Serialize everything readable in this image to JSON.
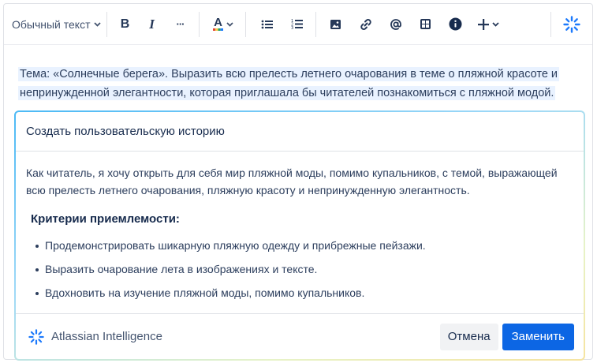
{
  "toolbar": {
    "text_style": "Обычный текст",
    "bold_label": "B",
    "italic_label": "I",
    "more_label": "···",
    "color_label": "A",
    "icons": [
      "chevron-down-icon",
      "bullet-list-icon",
      "numbered-list-icon",
      "image-icon",
      "link-icon",
      "mention-icon",
      "table-icon",
      "info-icon",
      "plus-icon",
      "atlassian-intelligence-icon"
    ]
  },
  "editor": {
    "selected_text": "Тема: «Солнечные берега». Выразить всю прелесть летнего очарования в теме о пляжной красоте и непринужденной элегантности, которая приглашала бы читателей познакомиться с пляжной модой."
  },
  "ai_panel": {
    "title": "Создать пользовательскую историю",
    "description": "Как читатель, я хочу открыть для себя мир пляжной моды, помимо купальников, с темой, выражающей всю прелесть летнего очарования, пляжную красоту и непринужденную элегантность.",
    "criteria_heading": "Критерии приемлемости:",
    "criteria": [
      "Продемонстрировать шикарную пляжную одежду и прибрежные пейзажи.",
      "Выразить очарование лета в изображениях и тексте.",
      "Вдохновить на изучение пляжной моды, помимо купальников."
    ],
    "brand": "Atlassian Intelligence",
    "cancel_label": "Отмена",
    "replace_label": "Заменить"
  },
  "colors": {
    "accent": "#0c66e4",
    "ai_blue": "#1d7afc",
    "highlight": "#e9f2ff",
    "color_a_stripe": [
      "#e34935",
      "#f5cd47",
      "#22a06b",
      "#1d7afc"
    ]
  }
}
